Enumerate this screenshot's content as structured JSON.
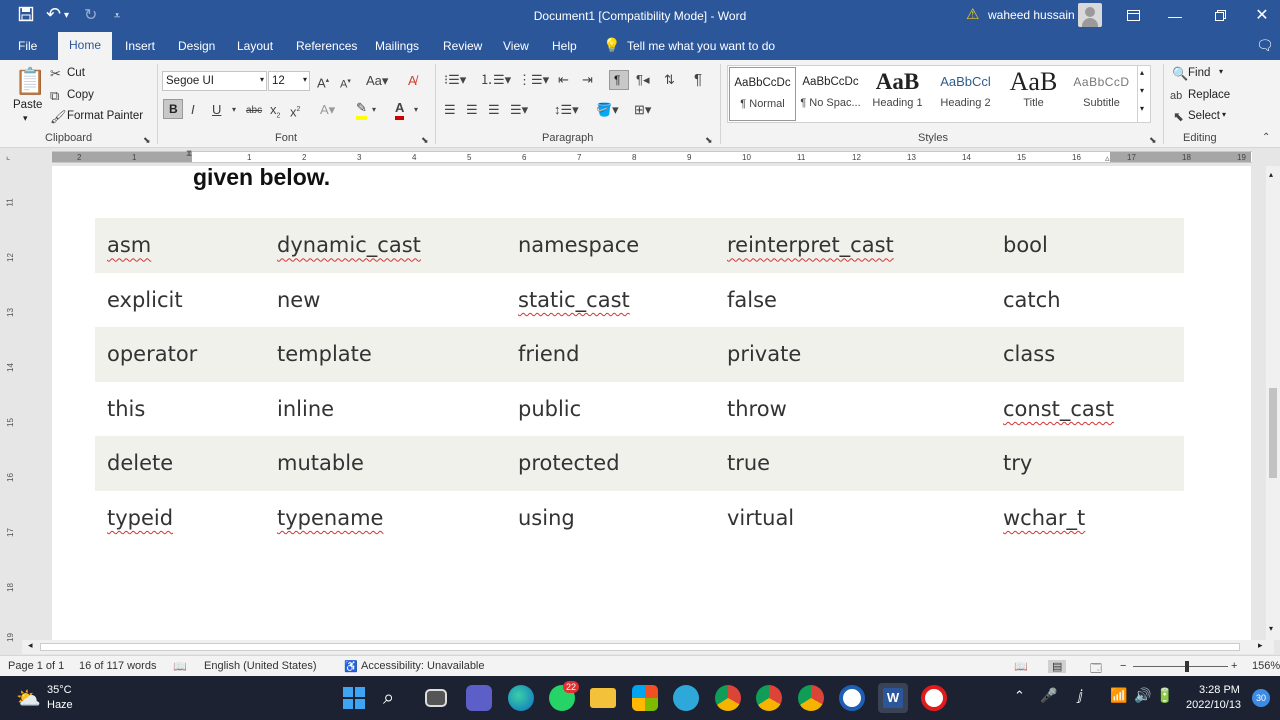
{
  "window": {
    "title": "Document1 [Compatibility Mode]  -  Word",
    "user_name": "waheed hussain",
    "warning_icon": "warning-icon",
    "controls": {
      "restore_ribbon": "ribbon-display-icon",
      "minimize": "minimize-icon",
      "maximize": "maximize-icon",
      "close": "close-icon"
    }
  },
  "quick_access": {
    "save": "save-icon",
    "undo": "undo-icon",
    "redo": "redo-icon",
    "customize": "customize-icon"
  },
  "menu_tabs": [
    "File",
    "Home",
    "Insert",
    "Design",
    "Layout",
    "References",
    "Mailings",
    "Review",
    "View",
    "Help"
  ],
  "tell_me": "Tell me what you want to do",
  "ribbon": {
    "clipboard": {
      "paste": "Paste",
      "cut": "Cut",
      "copy": "Copy",
      "format_painter": "Format Painter",
      "label": "Clipboard"
    },
    "font": {
      "name": "Segoe UI",
      "size": "12",
      "label": "Font"
    },
    "paragraph": {
      "label": "Paragraph"
    },
    "styles": {
      "label": "Styles",
      "items": [
        {
          "sample": "AaBbCcDc",
          "name": "¶ Normal"
        },
        {
          "sample": "AaBbCcDc",
          "name": "¶ No Spac..."
        },
        {
          "sample": "AaB",
          "name": "Heading 1"
        },
        {
          "sample": "AaBbCcl",
          "name": "Heading 2"
        },
        {
          "sample": "AaB",
          "name": "Title"
        },
        {
          "sample": "AaBbCcD",
          "name": "Subtitle"
        }
      ]
    },
    "editing": {
      "find": "Find",
      "replace": "Replace",
      "select": "Select",
      "label": "Editing"
    }
  },
  "ruler_numbers": [
    "2",
    "1",
    "1",
    "2",
    "3",
    "4",
    "5",
    "6",
    "7",
    "8",
    "9",
    "10",
    "11",
    "12",
    "13",
    "14",
    "15",
    "16",
    "17",
    "18",
    "19"
  ],
  "vertical_ruler_numbers": [
    "11",
    "12",
    "13",
    "14",
    "15",
    "16",
    "17",
    "18",
    "19"
  ],
  "document": {
    "heading": "given below.",
    "table": [
      [
        "asm",
        "dynamic_cast",
        "namespace",
        "reinterpret_cast",
        "bool"
      ],
      [
        "explicit",
        "new",
        "static_cast",
        "false",
        "catch"
      ],
      [
        "operator",
        "template",
        "friend",
        "private",
        "class"
      ],
      [
        "this",
        "inline",
        "public",
        "throw",
        "const_cast"
      ],
      [
        "delete",
        "mutable",
        "protected",
        "true",
        "try"
      ],
      [
        "typeid",
        "typename",
        "using",
        "virtual",
        "wchar_t"
      ]
    ],
    "spelling_flagged": [
      "asm",
      "dynamic_cast",
      "reinterpret_cast",
      "static_cast",
      "const_cast",
      "typeid",
      "typename",
      "wchar_t"
    ]
  },
  "status": {
    "page": "Page 1 of 1",
    "words": "16 of 117 words",
    "language": "English (United States)",
    "accessibility": "Accessibility: Unavailable",
    "zoom": "156%"
  },
  "taskbar": {
    "weather_temp": "35°C",
    "weather_desc": "Haze",
    "whatsapp_badge": "22",
    "time": "3:28 PM",
    "date": "2022/10/13",
    "notification_count": "30"
  },
  "colors": {
    "word_blue": "#2b579a",
    "row_shade": "#f1f1ec",
    "squiggle": "#d13438"
  }
}
